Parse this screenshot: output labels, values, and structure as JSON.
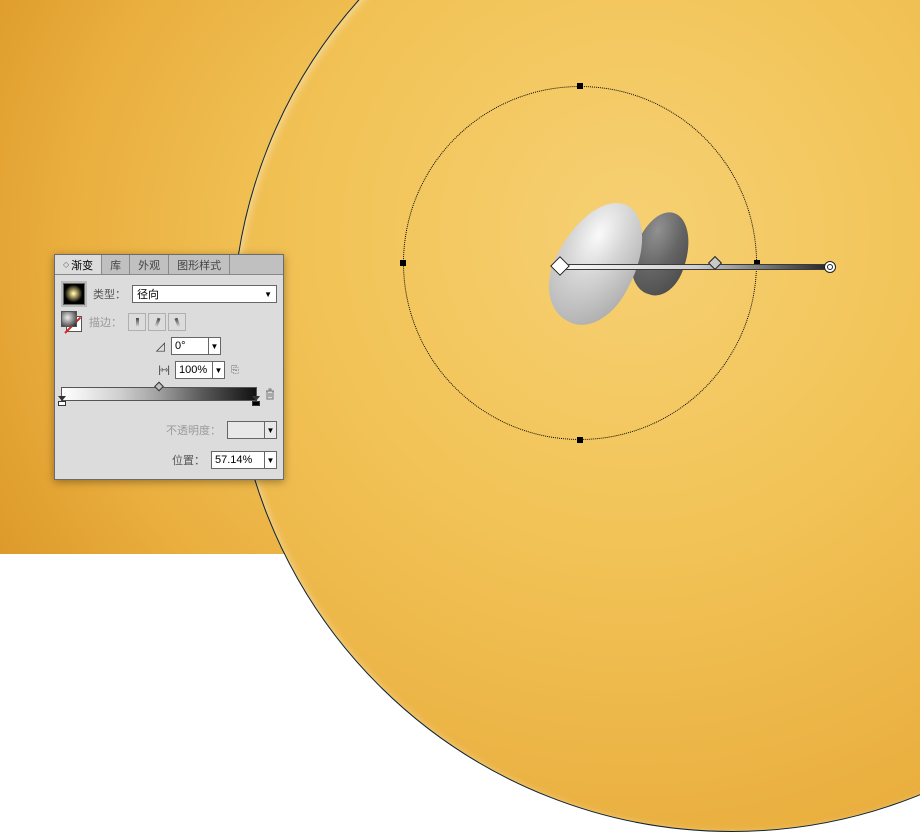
{
  "panel": {
    "tabs": {
      "gradient": "渐变",
      "library": "库",
      "appearance": "外观",
      "graphic_styles": "图形样式"
    },
    "type_label": "类型：",
    "type_value": "径向",
    "stroke_label": "描边：",
    "angle_value": "0°",
    "aspect_value": "100%",
    "opacity_label": "不透明度：",
    "opacity_value": "",
    "position_label": "位置：",
    "position_value": "57.14%"
  }
}
